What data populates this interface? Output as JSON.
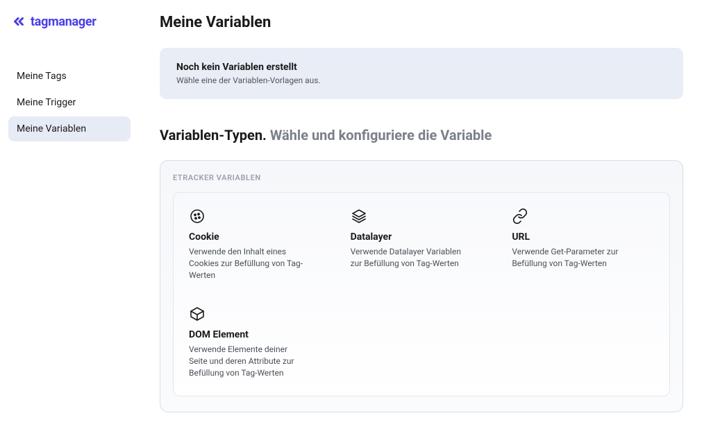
{
  "logo": {
    "text": "tagmanager"
  },
  "sidebar": {
    "items": [
      {
        "label": "Meine Tags",
        "active": false
      },
      {
        "label": "Meine Trigger",
        "active": false
      },
      {
        "label": "Meine Variablen",
        "active": true
      }
    ]
  },
  "page": {
    "title": "Meine Variablen"
  },
  "notice": {
    "title": "Noch kein Variablen erstellt",
    "subtitle": "Wähle eine der Variablen-Vorlagen aus."
  },
  "section": {
    "strong": "Variablen-Typen.",
    "light": "Wähle und konfiguriere die Variable"
  },
  "types": {
    "group_label": "ETRACKER VARIABLEN",
    "items": [
      {
        "icon": "cookie-icon",
        "title": "Cookie",
        "desc": "Verwende den Inhalt eines Cookies zur Befüllung von Tag-Werten"
      },
      {
        "icon": "layers-icon",
        "title": "Datalayer",
        "desc": "Verwende Datalayer Variablen zur Befüllung von Tag-Werten"
      },
      {
        "icon": "link-icon",
        "title": "URL",
        "desc": "Verwende Get-Parameter zur Befüllung von Tag-Werten"
      },
      {
        "icon": "box-icon",
        "title": "DOM Element",
        "desc": "Verwende Elemente deiner Seite und deren Attribute zur Befüllung von Tag-Werten"
      }
    ]
  }
}
